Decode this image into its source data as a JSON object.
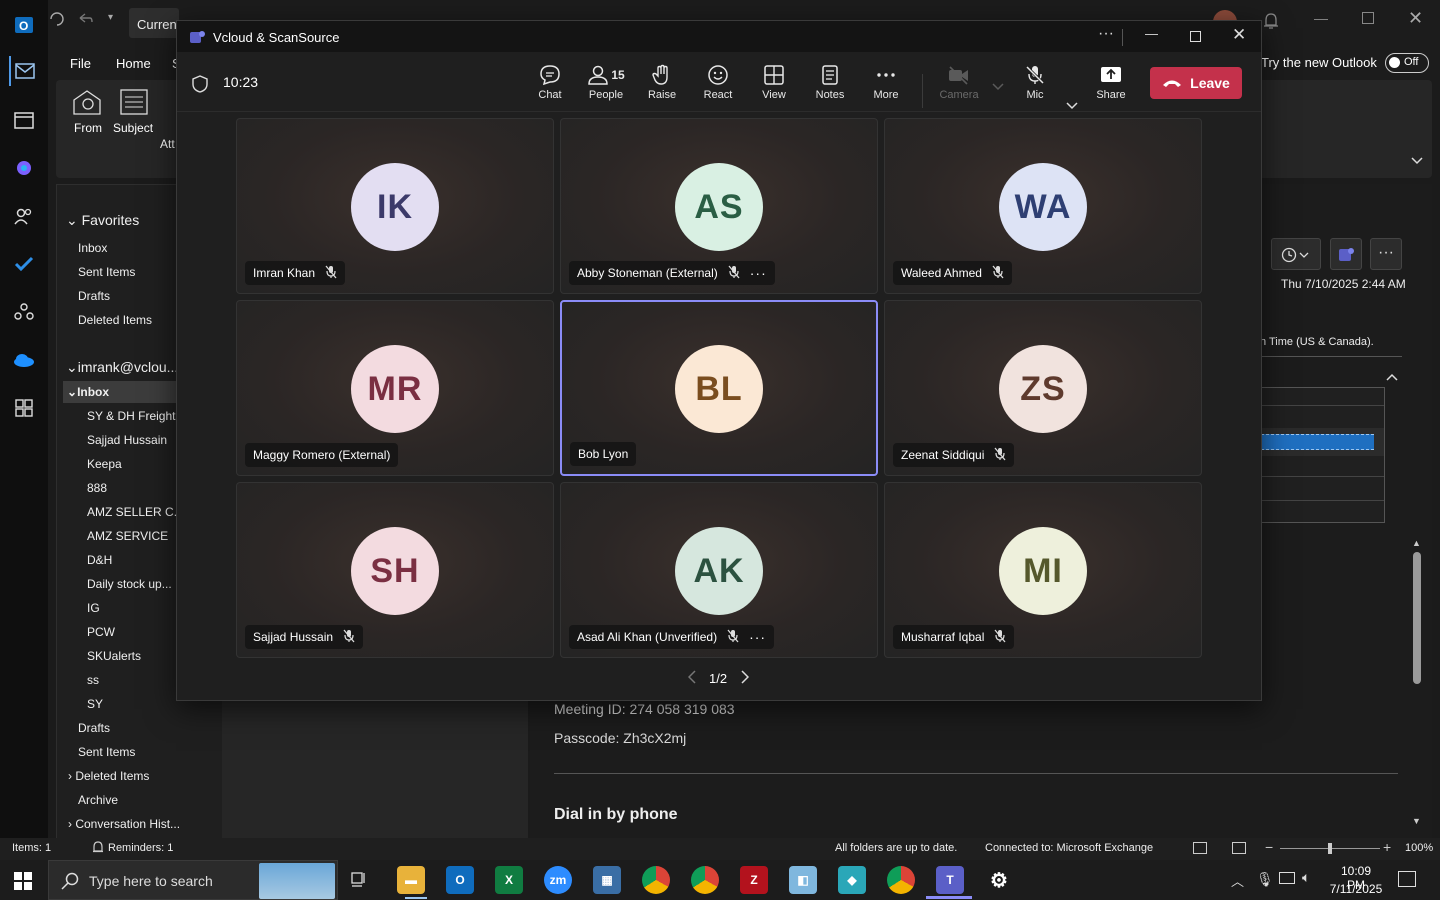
{
  "outlook": {
    "title_prefix": "Current",
    "tabs": [
      "File",
      "Home",
      "S"
    ],
    "ribbon": {
      "from_label": "From",
      "subject_label": "Subject",
      "att_label": "Att"
    },
    "try_new_outlook": "Try the new Outlook",
    "toggle_state": "Off",
    "favorites_header": "Favorites",
    "favorites": [
      "Inbox",
      "Sent Items",
      "Drafts",
      "Deleted Items"
    ],
    "account": "imrank@vclou...",
    "inbox_label": "Inbox",
    "inbox_subfolders": [
      "SY & DH Freights",
      "Sajjad Hussain",
      "Keepa",
      "888",
      "AMZ SELLER C...",
      "AMZ SERVICE",
      "D&H",
      "Daily stock up...",
      "IG",
      "PCW",
      "SKUalerts",
      "ss",
      "SY"
    ],
    "account_folders": [
      "Drafts",
      "Sent Items",
      "Deleted Items",
      "Archive",
      "Conversation Hist..."
    ],
    "reading": {
      "date": "Thu 7/10/2025 2:44 AM",
      "timezone_fragment": "n Time (US & Canada).",
      "meeting_id": "Meeting ID: 274 058 319 083",
      "passcode": "Passcode: Zh3cX2mj",
      "dial_in": "Dial in by phone"
    },
    "status": {
      "items": "Items: 1",
      "reminders": "Reminders: 1",
      "sync": "All folders are up to date.",
      "connection": "Connected to: Microsoft Exchange",
      "zoom": "100%",
      "zoom_level": 0.5
    }
  },
  "teams": {
    "window_title": "Vcloud & ScanSource",
    "timer": "10:23",
    "toolbar": {
      "chat": "Chat",
      "people": "People",
      "people_count": "15",
      "raise": "Raise",
      "react": "React",
      "view": "View",
      "notes": "Notes",
      "more": "More",
      "camera": "Camera",
      "mic": "Mic",
      "share": "Share",
      "leave": "Leave"
    },
    "participants": [
      {
        "initials": "IK",
        "name": "Imran Khan",
        "muted": true,
        "more": false,
        "bg": "#e3def2",
        "fg": "#3c3a6a"
      },
      {
        "initials": "AS",
        "name": "Abby Stoneman (External)",
        "muted": true,
        "more": true,
        "bg": "#d9f0e3",
        "fg": "#2a5e44"
      },
      {
        "initials": "WA",
        "name": "Waleed Ahmed",
        "muted": true,
        "more": false,
        "bg": "#dde3f5",
        "fg": "#2e3f73"
      },
      {
        "initials": "MR",
        "name": "Maggy Romero (External)",
        "muted": false,
        "more": false,
        "bg": "#f3dbe0",
        "fg": "#7a2f42"
      },
      {
        "initials": "BL",
        "name": "Bob Lyon",
        "muted": false,
        "more": false,
        "bg": "#fbe8d5",
        "fg": "#7a4d1f"
      },
      {
        "initials": "ZS",
        "name": "Zeenat Siddiqui",
        "muted": true,
        "more": false,
        "bg": "#f1e3de",
        "fg": "#5e3a2d"
      },
      {
        "initials": "SH",
        "name": "Sajjad Hussain",
        "muted": true,
        "more": false,
        "bg": "#f3dbe0",
        "fg": "#7a2f42"
      },
      {
        "initials": "AK",
        "name": "Asad Ali Khan (Unverified)",
        "muted": true,
        "more": true,
        "bg": "#d6e7de",
        "fg": "#2c5240"
      },
      {
        "initials": "MI",
        "name": "Musharraf Iqbal",
        "muted": true,
        "more": false,
        "bg": "#eef0dc",
        "fg": "#55582c"
      }
    ],
    "pagination": "1/2"
  },
  "taskbar": {
    "search_placeholder": "Type here to search",
    "time": "10:09 PM",
    "date": "7/11/2025"
  }
}
